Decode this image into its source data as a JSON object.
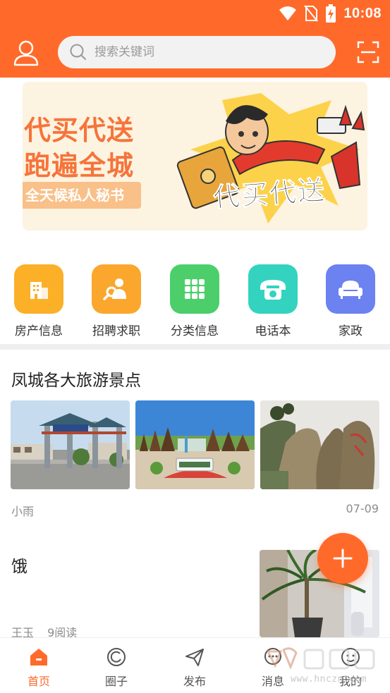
{
  "status_bar": {
    "time": "10:08"
  },
  "header": {
    "search_placeholder": "搜索关键词"
  },
  "banner": {
    "line1": "代买代送",
    "line2": "跑遍全城",
    "tag": "全天候私人秘书",
    "art_title": "代买代送"
  },
  "categories": [
    {
      "label": "房产信息",
      "icon": "building-icon",
      "color": "#fbb027"
    },
    {
      "label": "招聘求职",
      "icon": "recruit-icon",
      "color": "#fba72d"
    },
    {
      "label": "分类信息",
      "icon": "grid-icon",
      "color": "#4ccf6b"
    },
    {
      "label": "电话本",
      "icon": "phone-icon",
      "color": "#33d3c0"
    },
    {
      "label": "家政",
      "icon": "sofa-icon",
      "color": "#6b82f0"
    }
  ],
  "posts": [
    {
      "title": "凤城各大旅游景点",
      "author": "小雨",
      "date": "07-09",
      "images": [
        "scenic-gate-image",
        "scenic-park-image",
        "scenic-rock-image"
      ]
    },
    {
      "title": "饿",
      "author": "王玉",
      "reads": "9阅读",
      "image": "plant-image"
    }
  ],
  "tabs": [
    {
      "label": "首页",
      "icon": "home-icon",
      "active": true
    },
    {
      "label": "圈子",
      "icon": "circle-icon",
      "active": false
    },
    {
      "label": "发布",
      "icon": "send-icon",
      "active": false
    },
    {
      "label": "消息",
      "icon": "message-icon",
      "active": false
    },
    {
      "label": "我的",
      "icon": "profile-icon",
      "active": false
    }
  ],
  "watermark": {
    "text": "www.hnczn.com"
  },
  "colors": {
    "accent": "#ff6a2b",
    "divider": "#efefef",
    "meta_text": "#8c8c8c"
  }
}
